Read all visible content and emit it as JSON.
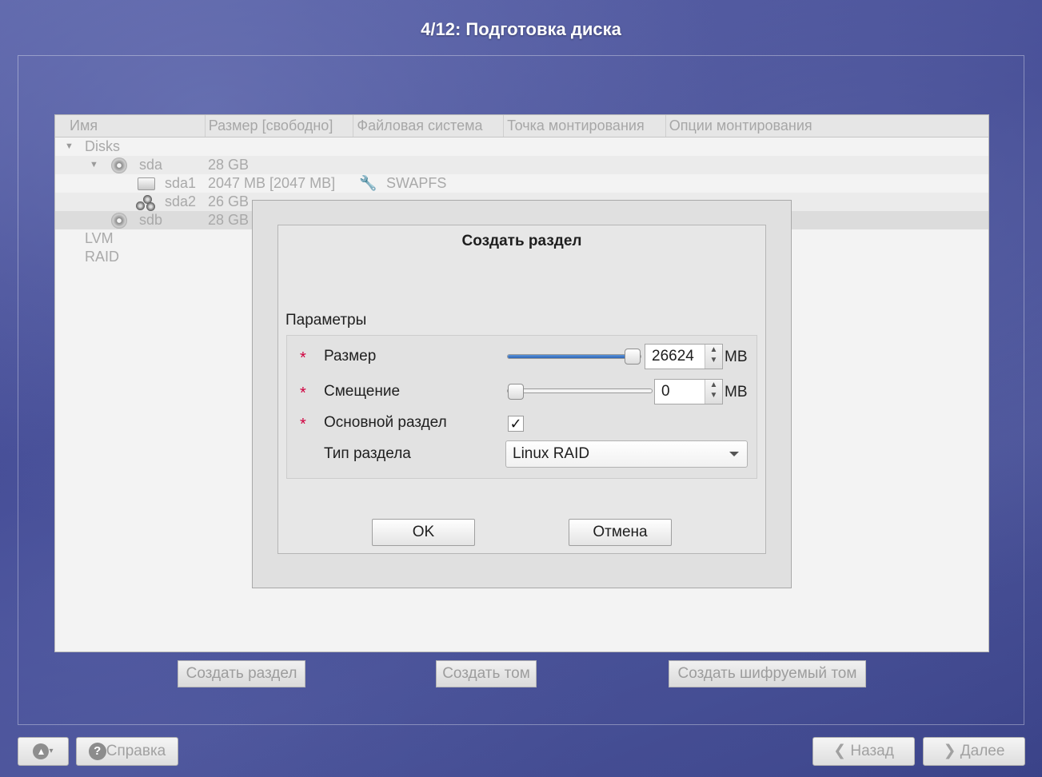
{
  "window": {
    "title": "4/12: Подготовка диска"
  },
  "tree": {
    "columns": [
      "Имя",
      "Размер [свободно]",
      "Файловая система",
      "Точка монтирования",
      "Опции монтирования"
    ],
    "rows": {
      "disks": {
        "name": "Disks"
      },
      "sda": {
        "name": "sda",
        "size": "28 GB"
      },
      "sda1": {
        "name": "sda1",
        "size": "2047 MB [2047 MB]",
        "fs": "SWAPFS"
      },
      "sda2": {
        "name": "sda2",
        "size": "26 GB"
      },
      "sdb": {
        "name": "sdb",
        "size": "28 GB"
      },
      "lvm": {
        "name": "LVM"
      },
      "raid": {
        "name": "RAID"
      }
    }
  },
  "actions": {
    "create_partition": "Создать раздел",
    "create_volume": "Создать том",
    "create_encrypted": "Создать шифруемый том"
  },
  "dialog": {
    "title": "Создать раздел",
    "params_label": "Параметры",
    "size": {
      "label": "Размер",
      "value": "26624",
      "unit": "MB",
      "slider_fraction": 1.0
    },
    "offset": {
      "label": "Смещение",
      "value": "0",
      "unit": "MB",
      "slider_fraction": 0.0
    },
    "primary": {
      "label": "Основной раздел",
      "checked": true,
      "mark": "✓"
    },
    "type": {
      "label": "Тип раздела",
      "value": "Linux RAID"
    },
    "required_mark": "*",
    "ok": "OK",
    "cancel": "Отмена"
  },
  "bottom": {
    "help": "Справка",
    "back": "Назад",
    "next": "Далее"
  }
}
